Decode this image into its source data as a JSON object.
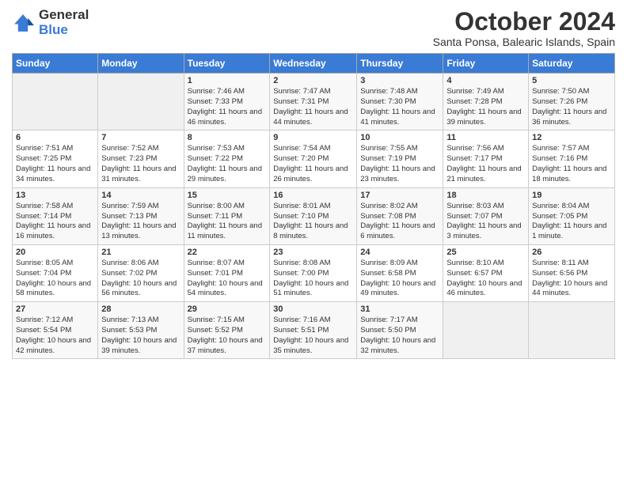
{
  "logo": {
    "general": "General",
    "blue": "Blue"
  },
  "title": "October 2024",
  "location": "Santa Ponsa, Balearic Islands, Spain",
  "days_of_week": [
    "Sunday",
    "Monday",
    "Tuesday",
    "Wednesday",
    "Thursday",
    "Friday",
    "Saturday"
  ],
  "weeks": [
    [
      {
        "day": "",
        "sunrise": "",
        "sunset": "",
        "daylight": ""
      },
      {
        "day": "",
        "sunrise": "",
        "sunset": "",
        "daylight": ""
      },
      {
        "day": "1",
        "sunrise": "Sunrise: 7:46 AM",
        "sunset": "Sunset: 7:33 PM",
        "daylight": "Daylight: 11 hours and 46 minutes."
      },
      {
        "day": "2",
        "sunrise": "Sunrise: 7:47 AM",
        "sunset": "Sunset: 7:31 PM",
        "daylight": "Daylight: 11 hours and 44 minutes."
      },
      {
        "day": "3",
        "sunrise": "Sunrise: 7:48 AM",
        "sunset": "Sunset: 7:30 PM",
        "daylight": "Daylight: 11 hours and 41 minutes."
      },
      {
        "day": "4",
        "sunrise": "Sunrise: 7:49 AM",
        "sunset": "Sunset: 7:28 PM",
        "daylight": "Daylight: 11 hours and 39 minutes."
      },
      {
        "day": "5",
        "sunrise": "Sunrise: 7:50 AM",
        "sunset": "Sunset: 7:26 PM",
        "daylight": "Daylight: 11 hours and 36 minutes."
      }
    ],
    [
      {
        "day": "6",
        "sunrise": "Sunrise: 7:51 AM",
        "sunset": "Sunset: 7:25 PM",
        "daylight": "Daylight: 11 hours and 34 minutes."
      },
      {
        "day": "7",
        "sunrise": "Sunrise: 7:52 AM",
        "sunset": "Sunset: 7:23 PM",
        "daylight": "Daylight: 11 hours and 31 minutes."
      },
      {
        "day": "8",
        "sunrise": "Sunrise: 7:53 AM",
        "sunset": "Sunset: 7:22 PM",
        "daylight": "Daylight: 11 hours and 29 minutes."
      },
      {
        "day": "9",
        "sunrise": "Sunrise: 7:54 AM",
        "sunset": "Sunset: 7:20 PM",
        "daylight": "Daylight: 11 hours and 26 minutes."
      },
      {
        "day": "10",
        "sunrise": "Sunrise: 7:55 AM",
        "sunset": "Sunset: 7:19 PM",
        "daylight": "Daylight: 11 hours and 23 minutes."
      },
      {
        "day": "11",
        "sunrise": "Sunrise: 7:56 AM",
        "sunset": "Sunset: 7:17 PM",
        "daylight": "Daylight: 11 hours and 21 minutes."
      },
      {
        "day": "12",
        "sunrise": "Sunrise: 7:57 AM",
        "sunset": "Sunset: 7:16 PM",
        "daylight": "Daylight: 11 hours and 18 minutes."
      }
    ],
    [
      {
        "day": "13",
        "sunrise": "Sunrise: 7:58 AM",
        "sunset": "Sunset: 7:14 PM",
        "daylight": "Daylight: 11 hours and 16 minutes."
      },
      {
        "day": "14",
        "sunrise": "Sunrise: 7:59 AM",
        "sunset": "Sunset: 7:13 PM",
        "daylight": "Daylight: 11 hours and 13 minutes."
      },
      {
        "day": "15",
        "sunrise": "Sunrise: 8:00 AM",
        "sunset": "Sunset: 7:11 PM",
        "daylight": "Daylight: 11 hours and 11 minutes."
      },
      {
        "day": "16",
        "sunrise": "Sunrise: 8:01 AM",
        "sunset": "Sunset: 7:10 PM",
        "daylight": "Daylight: 11 hours and 8 minutes."
      },
      {
        "day": "17",
        "sunrise": "Sunrise: 8:02 AM",
        "sunset": "Sunset: 7:08 PM",
        "daylight": "Daylight: 11 hours and 6 minutes."
      },
      {
        "day": "18",
        "sunrise": "Sunrise: 8:03 AM",
        "sunset": "Sunset: 7:07 PM",
        "daylight": "Daylight: 11 hours and 3 minutes."
      },
      {
        "day": "19",
        "sunrise": "Sunrise: 8:04 AM",
        "sunset": "Sunset: 7:05 PM",
        "daylight": "Daylight: 11 hours and 1 minute."
      }
    ],
    [
      {
        "day": "20",
        "sunrise": "Sunrise: 8:05 AM",
        "sunset": "Sunset: 7:04 PM",
        "daylight": "Daylight: 10 hours and 58 minutes."
      },
      {
        "day": "21",
        "sunrise": "Sunrise: 8:06 AM",
        "sunset": "Sunset: 7:02 PM",
        "daylight": "Daylight: 10 hours and 56 minutes."
      },
      {
        "day": "22",
        "sunrise": "Sunrise: 8:07 AM",
        "sunset": "Sunset: 7:01 PM",
        "daylight": "Daylight: 10 hours and 54 minutes."
      },
      {
        "day": "23",
        "sunrise": "Sunrise: 8:08 AM",
        "sunset": "Sunset: 7:00 PM",
        "daylight": "Daylight: 10 hours and 51 minutes."
      },
      {
        "day": "24",
        "sunrise": "Sunrise: 8:09 AM",
        "sunset": "Sunset: 6:58 PM",
        "daylight": "Daylight: 10 hours and 49 minutes."
      },
      {
        "day": "25",
        "sunrise": "Sunrise: 8:10 AM",
        "sunset": "Sunset: 6:57 PM",
        "daylight": "Daylight: 10 hours and 46 minutes."
      },
      {
        "day": "26",
        "sunrise": "Sunrise: 8:11 AM",
        "sunset": "Sunset: 6:56 PM",
        "daylight": "Daylight: 10 hours and 44 minutes."
      }
    ],
    [
      {
        "day": "27",
        "sunrise": "Sunrise: 7:12 AM",
        "sunset": "Sunset: 5:54 PM",
        "daylight": "Daylight: 10 hours and 42 minutes."
      },
      {
        "day": "28",
        "sunrise": "Sunrise: 7:13 AM",
        "sunset": "Sunset: 5:53 PM",
        "daylight": "Daylight: 10 hours and 39 minutes."
      },
      {
        "day": "29",
        "sunrise": "Sunrise: 7:15 AM",
        "sunset": "Sunset: 5:52 PM",
        "daylight": "Daylight: 10 hours and 37 minutes."
      },
      {
        "day": "30",
        "sunrise": "Sunrise: 7:16 AM",
        "sunset": "Sunset: 5:51 PM",
        "daylight": "Daylight: 10 hours and 35 minutes."
      },
      {
        "day": "31",
        "sunrise": "Sunrise: 7:17 AM",
        "sunset": "Sunset: 5:50 PM",
        "daylight": "Daylight: 10 hours and 32 minutes."
      },
      {
        "day": "",
        "sunrise": "",
        "sunset": "",
        "daylight": ""
      },
      {
        "day": "",
        "sunrise": "",
        "sunset": "",
        "daylight": ""
      }
    ]
  ]
}
